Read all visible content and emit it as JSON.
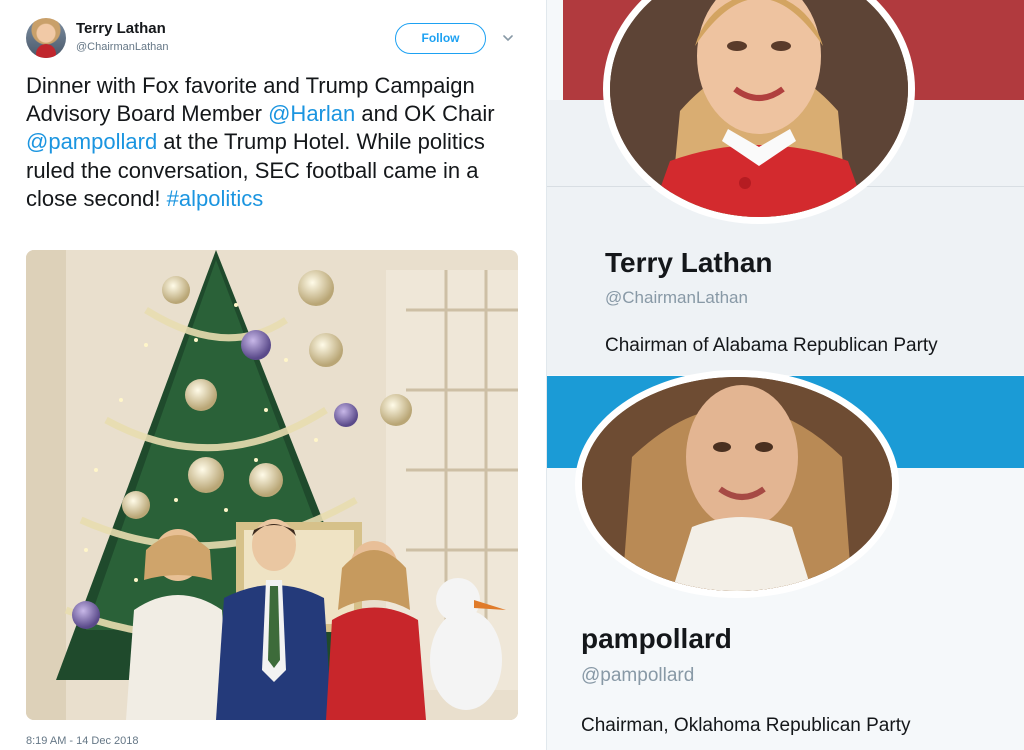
{
  "tweet": {
    "author_name": "Terry Lathan",
    "author_handle": "@ChairmanLathan",
    "follow_label": "Follow",
    "text": {
      "t1": "Dinner with Fox favorite and Trump Campaign Advisory Board Member ",
      "mention1": "@Harlan",
      "t2": " and OK Chair ",
      "mention2": "@pampollard",
      "t3": " at the Trump Hotel. While politics ruled the conversation, SEC football came in a close second! ",
      "hashtag": "#alpolitics"
    },
    "timestamp": "8:19 AM - 14 Dec 2018"
  },
  "profiles": [
    {
      "name": "Terry Lathan",
      "handle": "@ChairmanLathan",
      "bio": "Chairman of Alabama Republican Party",
      "banner_color": "#b13a3e"
    },
    {
      "name": "pampollard",
      "handle": "@pampollard",
      "bio": "Chairman, Oklahoma Republican Party",
      "banner_color": "#1b9bd6"
    }
  ],
  "colors": {
    "link": "#1b95e0",
    "follow": "#1da1f2",
    "muted": "#657786"
  },
  "icons": {
    "menu": "chevron-down-icon"
  }
}
